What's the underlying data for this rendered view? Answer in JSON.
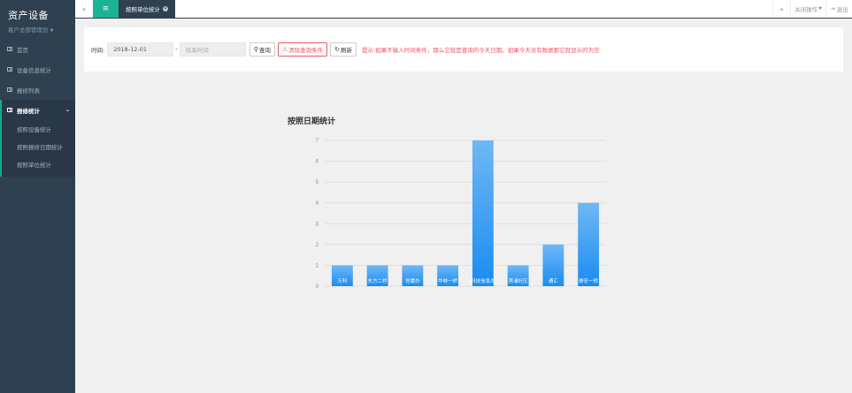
{
  "sidebar": {
    "app_title": "资产设备",
    "user_role": "客户总部管理员",
    "items": [
      {
        "label": "首页"
      },
      {
        "label": "设备信息统计"
      },
      {
        "label": "报修列表"
      },
      {
        "label": "报修统计"
      }
    ],
    "sub_items": [
      {
        "label": "按照设备统计"
      },
      {
        "label": "按照报修日期统计"
      },
      {
        "label": "按照单位统计"
      }
    ]
  },
  "topbar": {
    "tab_label": "按照单位统计",
    "close_ops_label": "关闭操作",
    "logout_label": "退出"
  },
  "search": {
    "time_label": "时间:",
    "start_value": "2018-12-01",
    "end_placeholder": "结束时间",
    "query_label": "查询",
    "clear_label": "清除查询条件",
    "refresh_label": "刷新",
    "hint": "提示:如果不输入时间条件，那么它就是查询的今天日期。如果今天没有数据那它就显示的为空"
  },
  "colors": {
    "sidebar_bg": "#2f4050",
    "accent": "#1ab394",
    "danger": "#ed5565",
    "bar_top": "#6fb8f5",
    "bar_bottom": "#1a8cf0"
  },
  "chart_data": {
    "type": "bar",
    "title": "按照日期统计",
    "categories": [
      "万科",
      "东方二桥",
      "党委办",
      "华林一桥",
      "科技信息办",
      "莲浦社区",
      "通汇",
      "静安一桥"
    ],
    "values": [
      1,
      1,
      1,
      1,
      7,
      1,
      2,
      4
    ],
    "ylim": [
      0,
      7
    ],
    "yticks": [
      0,
      1,
      2,
      3,
      4,
      5,
      6,
      7
    ],
    "grid": true
  }
}
